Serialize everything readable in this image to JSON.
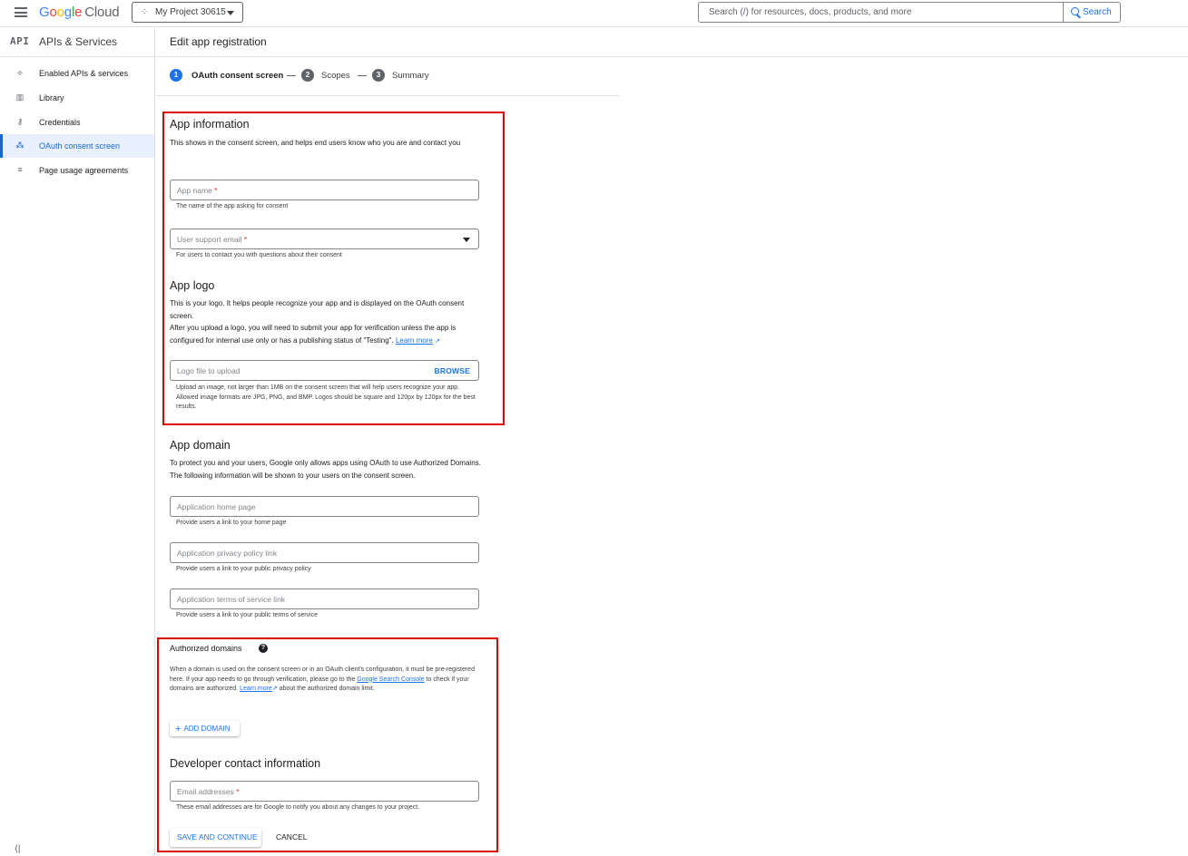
{
  "topbar": {
    "logo_google": [
      "G",
      "o",
      "o",
      "g",
      "l",
      "e"
    ],
    "logo_cloud": "Cloud",
    "project": "My Project 30615",
    "search_placeholder": "Search (/) for resources, docs, products, and more",
    "search_button": "Search"
  },
  "sidebar": {
    "api_badge": "API",
    "title": "APIs & Services",
    "items": [
      {
        "label": "Enabled APIs & services",
        "icon": "⟡"
      },
      {
        "label": "Library",
        "icon": "▥"
      },
      {
        "label": "Credentials",
        "icon": "⚷"
      },
      {
        "label": "OAuth consent screen",
        "icon": "⁂"
      },
      {
        "label": "Page usage agreements",
        "icon": "≡"
      }
    ],
    "active_item": "OAuth consent screen",
    "collapse": "⟨|"
  },
  "page": {
    "title": "Edit app registration",
    "steps": [
      {
        "num": "1",
        "label": "OAuth consent screen"
      },
      {
        "num": "2",
        "label": "Scopes"
      },
      {
        "num": "3",
        "label": "Summary"
      }
    ]
  },
  "app_info": {
    "heading": "App information",
    "description": "This shows in the consent screen, and helps end users know who you are and contact you",
    "app_name_placeholder": "App name",
    "app_name_hint": "The name of the app asking for consent",
    "support_email_placeholder": "User support email",
    "support_email_hint": "For users to contact you with questions about their consent",
    "required_mark": "*"
  },
  "app_logo": {
    "heading": "App logo",
    "desc1": "This is your logo. It helps people recognize your app and is displayed on the OAuth consent screen.",
    "desc2": "After you upload a logo, you will need to submit your app for verification unless the app is configured for internal use only or has a publishing status of \"Testing\".",
    "learn_more": "Learn more",
    "upload_placeholder": "Logo file to upload",
    "browse": "BROWSE",
    "upload_hint": "Upload an image, not larger than 1MB on the consent screen that will help users recognize your app. Allowed image formats are JPG, PNG, and BMP. Logos should be square and 120px by 120px for the best results."
  },
  "app_domain": {
    "heading": "App domain",
    "description": "To protect you and your users, Google only allows apps using OAuth to use Authorized Domains. The following information will be shown to your users on the consent screen.",
    "home_placeholder": "Application home page",
    "home_hint": "Provide users a link to your home page",
    "privacy_placeholder": "Application privacy policy link",
    "privacy_hint": "Provide users a link to your public privacy policy",
    "terms_placeholder": "Application terms of service link",
    "terms_hint": "Provide users a link to your public terms of service"
  },
  "authorized_domains": {
    "title": "Authorized domains",
    "help": "?",
    "text1": "When a domain is used on the consent screen or in an OAuth client's configuration, it must be pre-registered here. If your app needs to go through verification, please go to the",
    "link_console": "Google Search Console",
    "text2": "to check if your domains are authorized.",
    "learn_more": "Learn more",
    "text3": "about the authorized domain limit.",
    "add_button": "ADD DOMAIN"
  },
  "developer_contact": {
    "heading": "Developer contact information",
    "email_placeholder": "Email addresses",
    "email_hint": "These email addresses are for Google to notify you about any changes to your project."
  },
  "actions": {
    "save": "SAVE AND CONTINUE",
    "cancel": "CANCEL"
  },
  "colors": {
    "accent": "#1a73e8",
    "highlight_box": "#e00000"
  }
}
